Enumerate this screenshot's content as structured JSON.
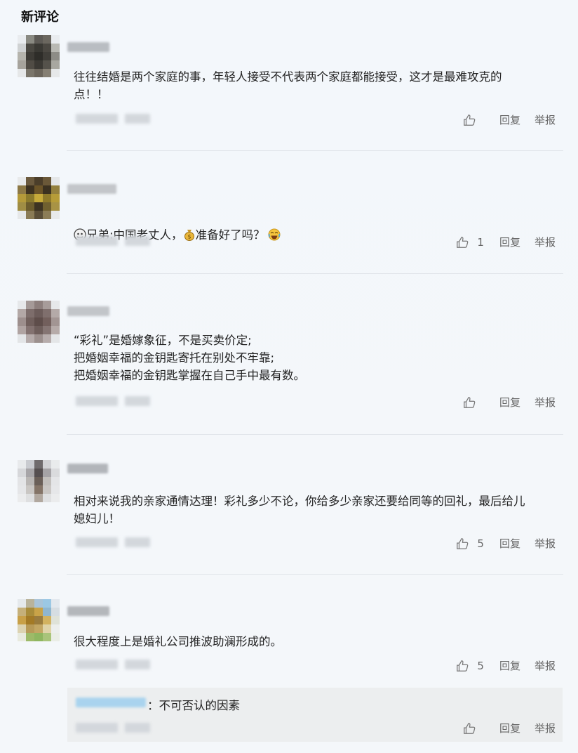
{
  "section_title": "新评论",
  "colors": {
    "accent_blue": "#a9d3ee",
    "text": "#222222",
    "muted": "#666666"
  },
  "actions": {
    "reply": "回复",
    "report": "举报"
  },
  "comments": [
    {
      "text": "往往结婚是两个家庭的事，年轻人接受不代表两个家庭都能接受，这才是最难攻克的\n点！！",
      "likes": ""
    },
    {
      "text_parts": [
        "兄弟:中国老丈人，",
        "准备好了吗？"
      ],
      "emoji_icons": [
        "ghost-face-icon",
        "money-bag-icon",
        "tears-of-joy-icon"
      ],
      "likes": "1"
    },
    {
      "text": "“彩礼”是婚嫁象征，不是买卖价定;\n把婚姻幸福的金钥匙寄托在别处不牢靠;\n把婚姻幸福的金钥匙掌握在自己手中最有数。",
      "likes": ""
    },
    {
      "text": "相对来说我的亲家通情达理！彩礼多少不论，你给多少亲家还要给同等的回礼，最后给儿\n媳妇儿！",
      "likes": "5"
    },
    {
      "text": "很大程度上是婚礼公司推波助澜形成的。",
      "likes": "5"
    }
  ],
  "reply": {
    "text": "：不可否认的因素",
    "likes": ""
  }
}
